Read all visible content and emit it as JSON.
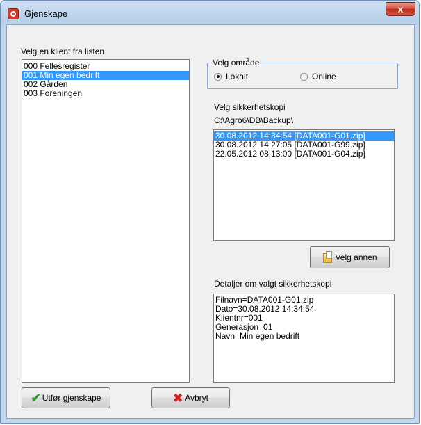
{
  "window": {
    "title": "Gjenskape",
    "close_label": "x"
  },
  "clients": {
    "label": "Velg en klient fra listen",
    "items": [
      {
        "label": "000 Fellesregister",
        "selected": false
      },
      {
        "label": "001 Min egen bedrift",
        "selected": true
      },
      {
        "label": "002 Gården",
        "selected": false
      },
      {
        "label": "003 Foreningen",
        "selected": false
      }
    ]
  },
  "area": {
    "group_label": "Velg område",
    "options": [
      {
        "label": "Lokalt",
        "checked": true
      },
      {
        "label": "Online",
        "checked": false
      }
    ]
  },
  "backup": {
    "label": "Velg sikkerhetskopi",
    "path": "C:\\Agro6\\DB\\Backup\\",
    "items": [
      {
        "label": "30.08.2012 14:34:54  [DATA001-G01.zip]",
        "selected": true
      },
      {
        "label": "30.08.2012 14:27:05  [DATA001-G99.zip]",
        "selected": false
      },
      {
        "label": "22.05.2012 08:13:00  [DATA001-G04.zip]",
        "selected": false
      }
    ],
    "choose_other_label": "Velg annen"
  },
  "details": {
    "label": "Detaljer om valgt sikkerhetskopi",
    "lines": [
      "Filnavn=DATA001-G01.zip",
      "Dato=30.08.2012 14:34:54",
      "Klientnr=001",
      "Generasjon=01",
      "Navn=Min egen bedrift"
    ]
  },
  "actions": {
    "restore_label": "Utfør gjenskape",
    "cancel_label": "Avbryt"
  },
  "colors": {
    "selection": "#3399ff",
    "close_button": "#c7432f",
    "title_bar": "#c4d7ee"
  },
  "icons": {
    "app": "app-gear-icon",
    "close": "close-icon",
    "choose_other": "folder-document-icon",
    "restore": "checkmark-icon",
    "cancel": "red-x-icon"
  }
}
